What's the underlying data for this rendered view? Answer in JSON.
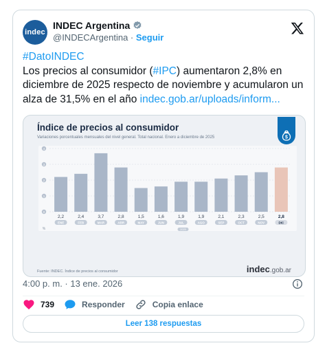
{
  "author": {
    "avatar_text": "indec",
    "display_name": "INDEC Argentina",
    "handle": "@INDECArgentina",
    "separator": " · ",
    "follow_label": "Seguir"
  },
  "tweet": {
    "hashtag1": "#DatoINDEC",
    "text_before": "Los precios al consumidor (",
    "hashtag2": "#IPC",
    "text_after": ") aumentaron 2,8% en diciembre de 2025 respecto de noviembre y acumularon un alza de 31,5% en el año ",
    "link": "indec.gob.ar/uploads/inform..."
  },
  "media": {
    "title": "Índice de precios al consumidor",
    "subtitle": "Variaciones porcentuales mensuales del nivel general. Total nacional. Enero a diciembre de 2025",
    "source": "Fuente: INDEC. Índice de precios al consumidor",
    "logo_bold": "indec",
    "logo_domain": ".gob.ar"
  },
  "chart_data": {
    "type": "bar",
    "categories": [
      "ENE",
      "FEB",
      "MAR",
      "ABR",
      "MAY",
      "JUN",
      "JUL",
      "AGO",
      "SEP",
      "OCT",
      "NOV",
      "DIC"
    ],
    "values": [
      2.2,
      2.4,
      3.7,
      2.8,
      1.5,
      1.6,
      1.9,
      1.9,
      2.1,
      2.3,
      2.5,
      2.8
    ],
    "value_labels": [
      "2,2",
      "2,4",
      "3,7",
      "2,8",
      "1,5",
      "1,6",
      "1,9",
      "1,9",
      "2,1",
      "2,3",
      "2,5",
      "2,8"
    ],
    "y_ticks": [
      "0",
      "1",
      "2",
      "3",
      "4"
    ],
    "y_unit": "%",
    "year_label": "2025",
    "ylim": [
      0,
      4
    ],
    "highlight_index": 11,
    "colors": {
      "bar": "#a9b6c8",
      "highlight": "#e9c5b8",
      "grid": "#d3d9e2"
    }
  },
  "meta": {
    "timestamp": "4:00 p. m. · 13 ene. 2026",
    "likes": "739",
    "reply_label": "Responder",
    "copy_label": "Copia enlace",
    "read_replies": "Leer 138 respuestas"
  },
  "colors": {
    "accent": "#1d9bf0",
    "like": "#f91880",
    "avatar": "#1c5d9c"
  }
}
